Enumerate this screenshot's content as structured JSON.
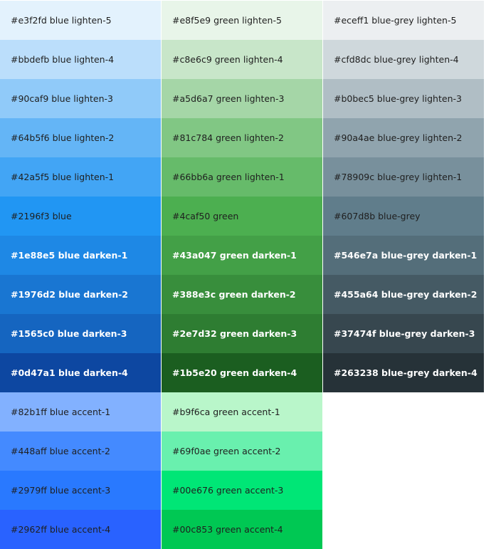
{
  "palette": {
    "blue": [
      {
        "hex": "#e3f2fd",
        "label": "#e3f2fd blue lighten-5",
        "dark": false
      },
      {
        "hex": "#bbdefb",
        "label": "#bbdefb blue lighten-4",
        "dark": false
      },
      {
        "hex": "#90caf9",
        "label": "#90caf9 blue lighten-3",
        "dark": false
      },
      {
        "hex": "#64b5f6",
        "label": "#64b5f6 blue lighten-2",
        "dark": false
      },
      {
        "hex": "#42a5f5",
        "label": "#42a5f5 blue lighten-1",
        "dark": false
      },
      {
        "hex": "#2196f3",
        "label": "#2196f3 blue",
        "dark": false
      },
      {
        "hex": "#1e88e5",
        "label": "#1e88e5 blue darken-1",
        "dark": true
      },
      {
        "hex": "#1976d2",
        "label": "#1976d2 blue darken-2",
        "dark": true
      },
      {
        "hex": "#1565c0",
        "label": "#1565c0 blue darken-3",
        "dark": true
      },
      {
        "hex": "#0d47a1",
        "label": "#0d47a1 blue darken-4",
        "dark": true
      },
      {
        "hex": "#82b1ff",
        "label": "#82b1ff blue accent-1",
        "dark": false
      },
      {
        "hex": "#448aff",
        "label": "#448aff blue accent-2",
        "dark": false
      },
      {
        "hex": "#2979ff",
        "label": "#2979ff blue accent-3",
        "dark": false
      },
      {
        "hex": "#2962ff",
        "label": "#2962ff blue accent-4",
        "dark": false
      }
    ],
    "green": [
      {
        "hex": "#e8f5e9",
        "label": "#e8f5e9 green lighten-5",
        "dark": false
      },
      {
        "hex": "#c8e6c9",
        "label": "#c8e6c9 green lighten-4",
        "dark": false
      },
      {
        "hex": "#a5d6a7",
        "label": "#a5d6a7 green lighten-3",
        "dark": false
      },
      {
        "hex": "#81c784",
        "label": "#81c784 green lighten-2",
        "dark": false
      },
      {
        "hex": "#66bb6a",
        "label": "#66bb6a green lighten-1",
        "dark": false
      },
      {
        "hex": "#4caf50",
        "label": "#4caf50 green",
        "dark": false
      },
      {
        "hex": "#43a047",
        "label": "#43a047 green darken-1",
        "dark": true
      },
      {
        "hex": "#388e3c",
        "label": "#388e3c green darken-2",
        "dark": true
      },
      {
        "hex": "#2e7d32",
        "label": "#2e7d32 green darken-3",
        "dark": true
      },
      {
        "hex": "#1b5e20",
        "label": "#1b5e20 green darken-4",
        "dark": true
      },
      {
        "hex": "#b9f6ca",
        "label": "#b9f6ca green accent-1",
        "dark": false
      },
      {
        "hex": "#69f0ae",
        "label": "#69f0ae green accent-2",
        "dark": false
      },
      {
        "hex": "#00e676",
        "label": "#00e676 green accent-3",
        "dark": false
      },
      {
        "hex": "#00c853",
        "label": "#00c853 green accent-4",
        "dark": false
      }
    ],
    "blue_grey": [
      {
        "hex": "#eceff1",
        "label": "#eceff1 blue-grey lighten-5",
        "dark": false
      },
      {
        "hex": "#cfd8dc",
        "label": "#cfd8dc blue-grey lighten-4",
        "dark": false
      },
      {
        "hex": "#b0bec5",
        "label": "#b0bec5 blue-grey lighten-3",
        "dark": false
      },
      {
        "hex": "#90a4ae",
        "label": "#90a4ae blue-grey lighten-2",
        "dark": false
      },
      {
        "hex": "#78909c",
        "label": "#78909c blue-grey lighten-1",
        "dark": false
      },
      {
        "hex": "#607d8b",
        "label": "#607d8b blue-grey",
        "dark": false
      },
      {
        "hex": "#546e7a",
        "label": "#546e7a blue-grey darken-1",
        "dark": true
      },
      {
        "hex": "#455a64",
        "label": "#455a64 blue-grey darken-2",
        "dark": true
      },
      {
        "hex": "#37474f",
        "label": "#37474f blue-grey darken-3",
        "dark": true
      },
      {
        "hex": "#263238",
        "label": "#263238 blue-grey darken-4",
        "dark": true
      }
    ]
  }
}
